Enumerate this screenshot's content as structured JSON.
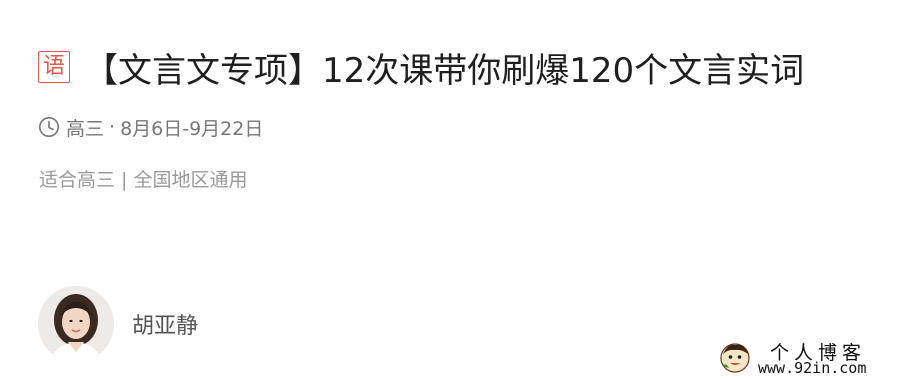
{
  "course": {
    "subject_tag": "语",
    "title": "【文言文专项】12次课带你刷爆120个文言实词",
    "grade": "高三",
    "separator": "·",
    "date_range": "8月6日-9月22日",
    "description": "适合高三 | 全国地区通用"
  },
  "teacher": {
    "name": "胡亚静",
    "avatar_icon": "teacher-avatar-photo"
  },
  "watermark": {
    "title": "个人博客",
    "url": "www.92in.com",
    "icon": "mascot-logo-icon"
  },
  "colors": {
    "subject_tag": "#e35a4f",
    "title": "#1f1f1f",
    "meta": "#777777",
    "description": "#9a9a9a",
    "teacher_name": "#555555"
  }
}
